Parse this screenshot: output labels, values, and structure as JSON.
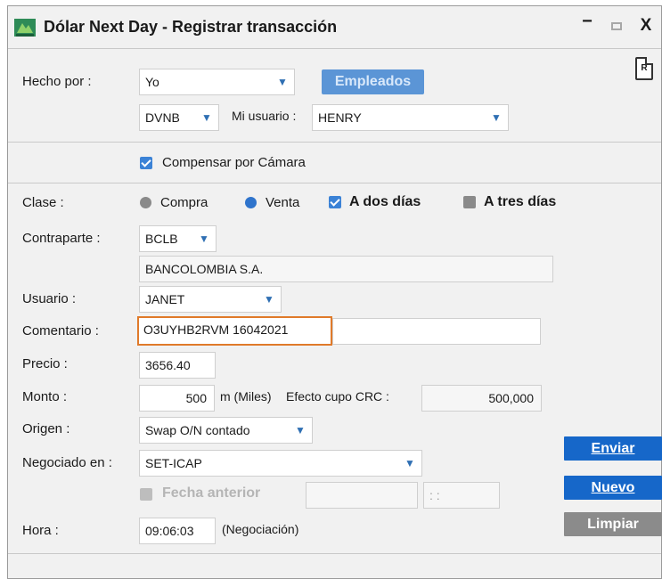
{
  "window": {
    "title": "Dólar Next Day - Registrar transacción",
    "minimize_glyph": "−",
    "close_glyph": "X",
    "report_icon_label": "R"
  },
  "hecho_por": {
    "label": "Hecho por :",
    "value": "Yo",
    "empleados_button": "Empleados"
  },
  "mi_usuario": {
    "entity_value": "DVNB",
    "label": "Mi usuario :",
    "value": "HENRY"
  },
  "compensar": {
    "label": "Compensar por Cámara",
    "checked": true
  },
  "clase": {
    "label": "Clase :",
    "options": [
      {
        "label": "Compra",
        "selected": false
      },
      {
        "label": "Venta",
        "selected": true
      }
    ],
    "a_dos_dias": {
      "label": "A dos días",
      "checked": true
    },
    "a_tres_dias": {
      "label": "A tres días",
      "checked": false
    }
  },
  "contraparte": {
    "label": "Contraparte :",
    "code": "BCLB",
    "name": "BANCOLOMBIA S.A."
  },
  "usuario": {
    "label": "Usuario :",
    "value": "JANET"
  },
  "comentario": {
    "label": "Comentario :",
    "value": "O3UYHB2RVM 16042021"
  },
  "precio": {
    "label": "Precio :",
    "value": "3656.40"
  },
  "monto": {
    "label": "Monto :",
    "value": "500",
    "unit": "m (Miles)",
    "efecto_label": "Efecto cupo CRC :",
    "efecto_value": "500,000"
  },
  "origen": {
    "label": "Origen :",
    "value": "Swap O/N contado"
  },
  "negociado": {
    "label": "Negociado en :",
    "value": "SET-ICAP"
  },
  "fecha_anterior": {
    "label": "Fecha anterior",
    "date_value": "",
    "time_value": ": :"
  },
  "hora": {
    "label": "Hora :",
    "value": "09:06:03",
    "note": "(Negociación)"
  },
  "actions": {
    "enviar": "Enviar",
    "nuevo": "Nuevo",
    "limpiar": "Limpiar"
  },
  "colors": {
    "accent_blue": "#1667c9",
    "focus_orange": "#e07a2a",
    "disabled_gray": "#8b8b8b"
  }
}
